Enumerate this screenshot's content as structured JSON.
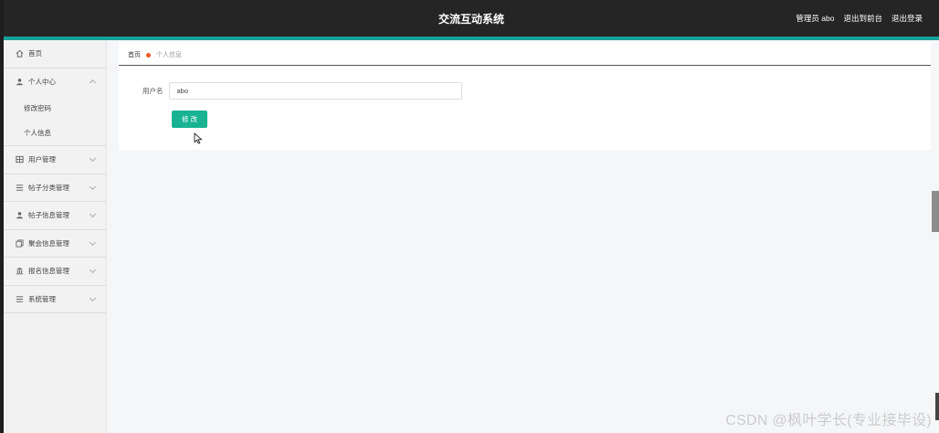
{
  "header": {
    "title": "交流互动系统",
    "user": "管理员 abo",
    "links": [
      "退出到前台",
      "退出登录"
    ]
  },
  "sidebar": {
    "items": [
      {
        "label": "首页",
        "icon": "home-icon"
      },
      {
        "label": "个人中心",
        "icon": "user-icon",
        "expanded": true,
        "children": [
          "修改密码",
          "个人信息"
        ]
      },
      {
        "label": "用户管理",
        "icon": "grid-icon"
      },
      {
        "label": "帖子分类管理",
        "icon": "list-icon"
      },
      {
        "label": "帖子信息管理",
        "icon": "user-icon"
      },
      {
        "label": "聚会信息管理",
        "icon": "copy-icon"
      },
      {
        "label": "报名信息管理",
        "icon": "bank-icon"
      },
      {
        "label": "系统管理",
        "icon": "list-icon"
      }
    ]
  },
  "breadcrumb": {
    "home": "首页",
    "current": "个人信息"
  },
  "form": {
    "username_label": "用户名",
    "username_value": "abo",
    "submit_label": "修 改"
  },
  "watermark": "CSDN @枫叶学长(专业接毕设)",
  "colors": {
    "accent": "#18a09a",
    "button": "#19b394",
    "breadcrumb_dot": "#f05a23",
    "topbar": "#252525"
  }
}
